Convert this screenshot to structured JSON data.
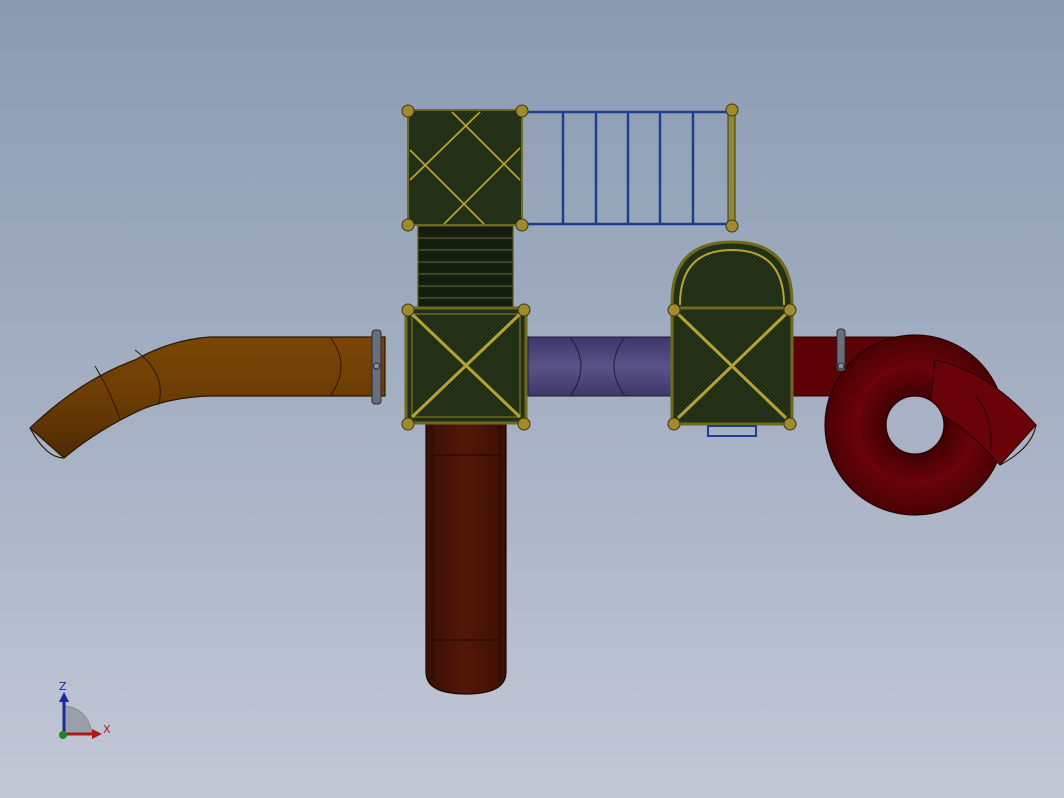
{
  "viewport": {
    "background_top": "#8a9bb1",
    "background_bottom": "#c3c8d6"
  },
  "triad": {
    "z_label": "Z",
    "x_label": "X",
    "z_color": "#1d2a9c",
    "x_color": "#b01818",
    "y_color": "#1a8a1a"
  },
  "model": {
    "colors": {
      "deck_fill": "#1b2a12",
      "deck_frame": "#6f6a1e",
      "brace": "#b6a233",
      "post_cap": "#a08a2c",
      "climber_rungs": "#1e3f8f",
      "climber_rails": "#8f8a3a",
      "tube_slide_left": "#6b3c04",
      "tunnel_purple": "#4b4477",
      "straight_slide": "#4a1405",
      "spiral_slide": "#5c0206",
      "clamp": "#6b6e7a"
    },
    "icons": [
      "deck-panel",
      "horizontal-climber",
      "tube-slide",
      "tunnel",
      "spiral-slide",
      "arch-roof",
      "straight-slide",
      "view-triad"
    ]
  }
}
